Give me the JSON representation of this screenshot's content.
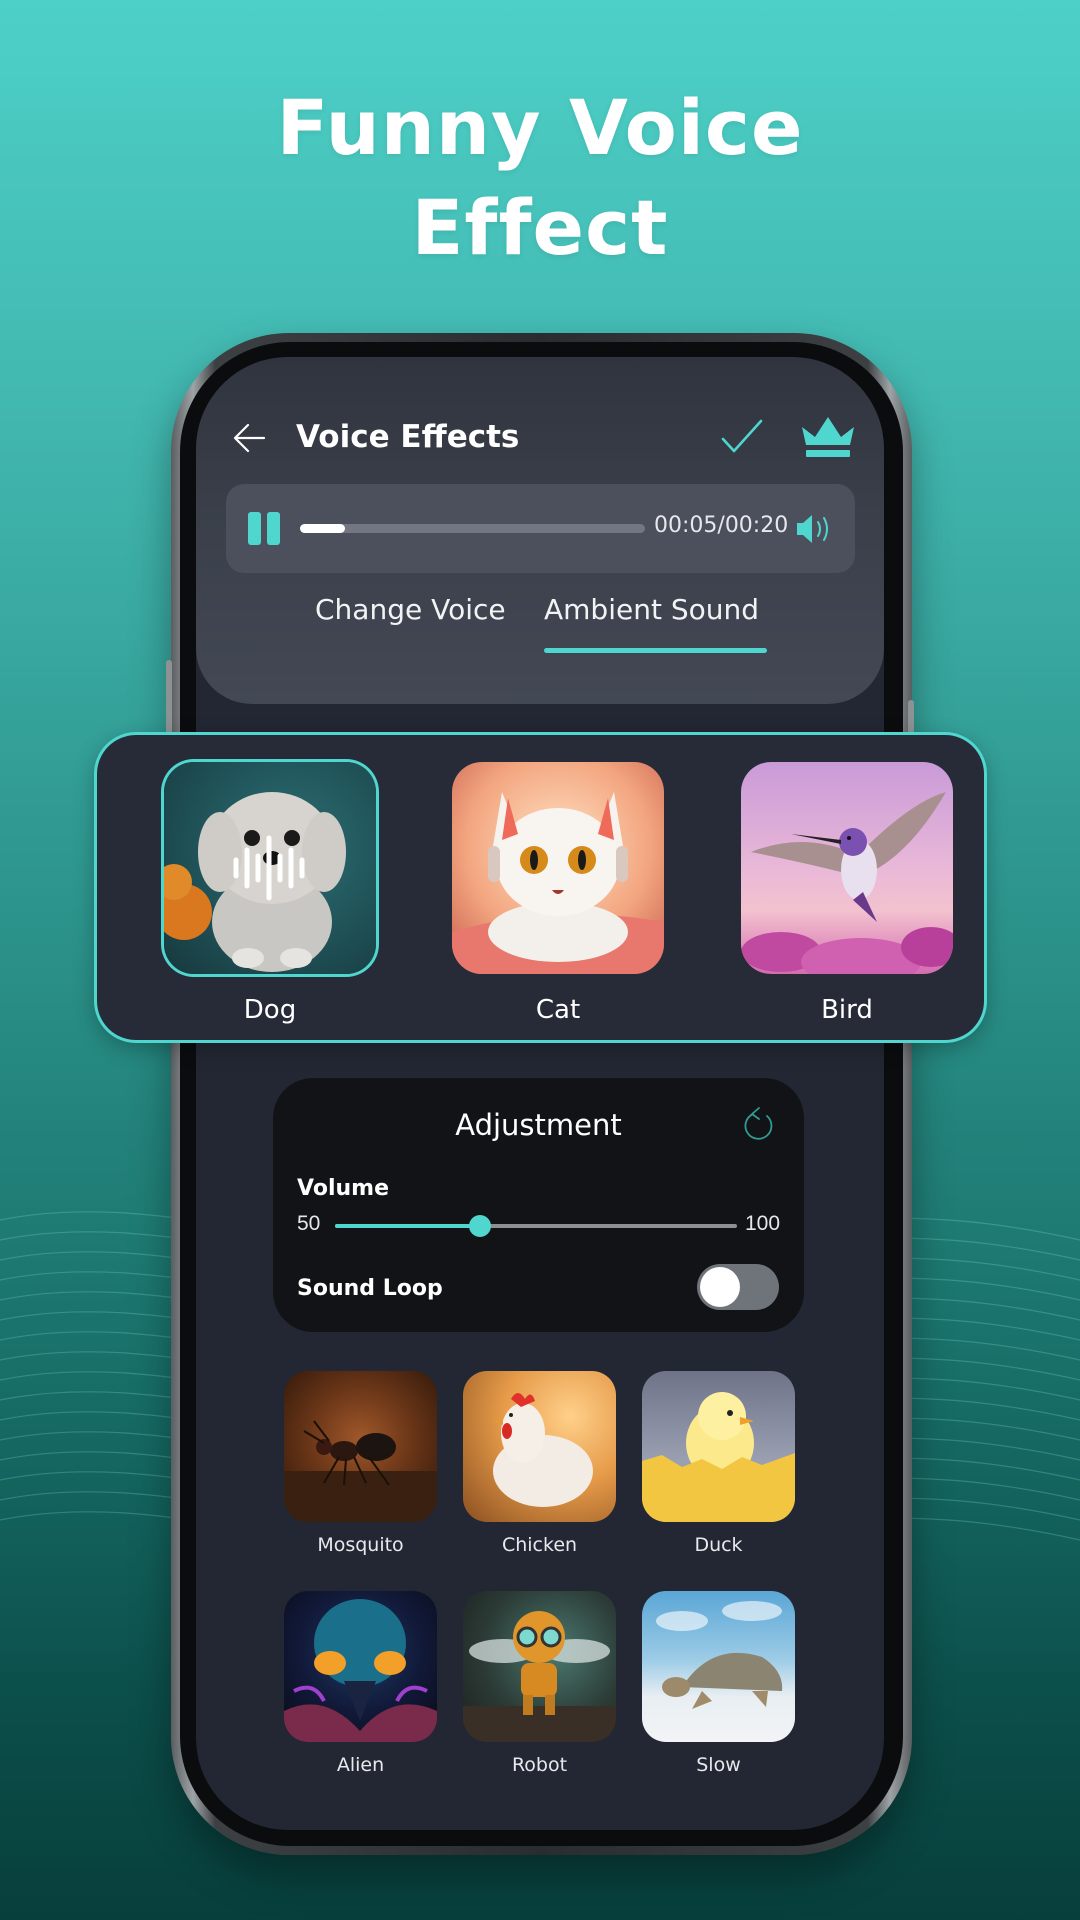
{
  "headline": {
    "line1": "Funny Voice",
    "line2": "Effect"
  },
  "app": {
    "header": {
      "title": "Voice Effects",
      "back_icon": "arrow-left-icon",
      "confirm_icon": "check-icon",
      "premium_icon": "crown-icon"
    },
    "player": {
      "state": "playing",
      "control_icon": "pause-icon",
      "progress_fraction": 0.13,
      "time": "00:05/00:20",
      "volume_icon": "speaker-icon"
    },
    "tabs": [
      {
        "label": "Change Voice",
        "active": false
      },
      {
        "label": "Ambient Sound",
        "active": true
      }
    ],
    "featured_effects": [
      {
        "label": "Dog",
        "selected": true,
        "overlay_icon": "waveform-icon"
      },
      {
        "label": "Cat",
        "selected": false
      },
      {
        "label": "Bird",
        "selected": false
      }
    ],
    "adjustment": {
      "title": "Adjustment",
      "reset_icon": "reset-icon",
      "volume": {
        "label": "Volume",
        "min_label": "50",
        "max_label": "100",
        "min": 50,
        "max": 100,
        "value": 68
      },
      "sound_loop": {
        "label": "Sound Loop",
        "enabled": false
      }
    },
    "effects": [
      {
        "label": "Mosquito"
      },
      {
        "label": "Chicken"
      },
      {
        "label": "Duck"
      },
      {
        "label": "Alien"
      },
      {
        "label": "Robot"
      },
      {
        "label": "Slow"
      }
    ]
  },
  "colors": {
    "accent": "#4ed6cf",
    "screen_bg": "#222733",
    "panel_bg": "#3f4450",
    "card_bg": "#121316"
  }
}
